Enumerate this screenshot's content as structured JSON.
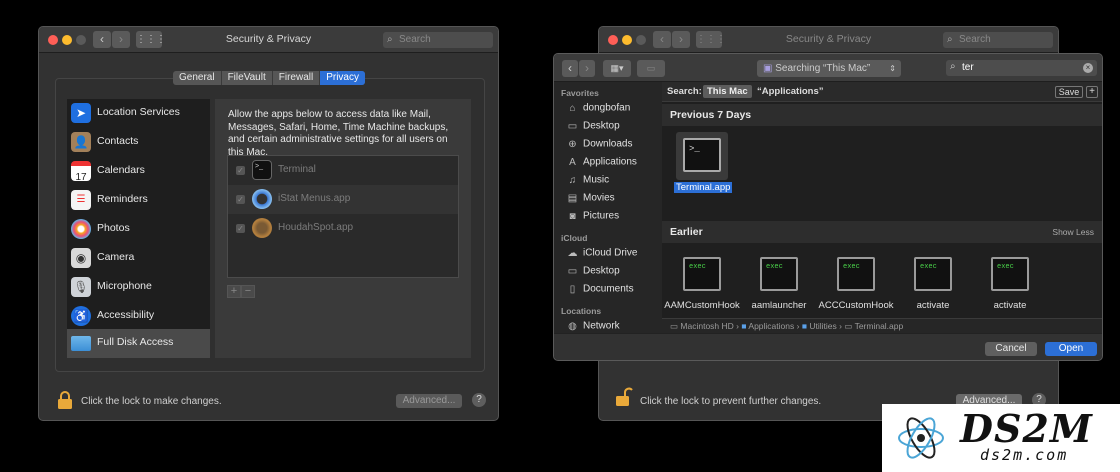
{
  "left_window": {
    "title": "Security & Privacy",
    "search_placeholder": "Search",
    "tabs": [
      "General",
      "FileVault",
      "Firewall",
      "Privacy"
    ],
    "active_tab": "Privacy",
    "sidebar": [
      {
        "label": "Location Services",
        "icon": "location-icon"
      },
      {
        "label": "Contacts",
        "icon": "contacts-icon"
      },
      {
        "label": "Calendars",
        "icon": "calendar-icon",
        "calendar_day": "17"
      },
      {
        "label": "Reminders",
        "icon": "reminders-icon"
      },
      {
        "label": "Photos",
        "icon": "photos-icon"
      },
      {
        "label": "Camera",
        "icon": "camera-icon"
      },
      {
        "label": "Microphone",
        "icon": "microphone-icon"
      },
      {
        "label": "Accessibility",
        "icon": "accessibility-icon"
      },
      {
        "label": "Full Disk Access",
        "icon": "folder-icon",
        "selected": true
      }
    ],
    "description": "Allow the apps below to access data like Mail, Messages, Safari, Home, Time Machine backups, and certain administrative settings for all users on this Mac.",
    "apps": [
      {
        "name": "Terminal",
        "checked": true
      },
      {
        "name": "iStat Menus.app",
        "checked": true
      },
      {
        "name": "HoudahSpot.app",
        "checked": true
      }
    ],
    "add_label": "+",
    "remove_label": "−",
    "lock_text": "Click the lock to make changes.",
    "advanced_label": "Advanced...",
    "help_label": "?"
  },
  "right_window": {
    "title": "Security & Privacy",
    "search_placeholder": "Search",
    "lock_text": "Click the lock to prevent further changes.",
    "advanced_label": "Advanced...",
    "help_label": "?"
  },
  "dialog": {
    "location_popup": "Searching “This Mac”",
    "search_value": "ter",
    "sidebar": {
      "favorites_header": "Favorites",
      "favorites": [
        {
          "label": "dongbofan",
          "icon": "home-icon"
        },
        {
          "label": "Desktop",
          "icon": "desktop-icon"
        },
        {
          "label": "Downloads",
          "icon": "downloads-icon"
        },
        {
          "label": "Applications",
          "icon": "applications-icon"
        },
        {
          "label": "Music",
          "icon": "music-icon"
        },
        {
          "label": "Movies",
          "icon": "movies-icon"
        },
        {
          "label": "Pictures",
          "icon": "pictures-icon"
        }
      ],
      "icloud_header": "iCloud",
      "icloud": [
        {
          "label": "iCloud Drive",
          "icon": "cloud-icon"
        },
        {
          "label": "Desktop",
          "icon": "desktop-icon"
        },
        {
          "label": "Documents",
          "icon": "documents-icon"
        }
      ],
      "locations_header": "Locations",
      "locations": [
        {
          "label": "Network",
          "icon": "network-icon"
        }
      ]
    },
    "scope_label": "Search:",
    "scope_this_mac": "This Mac",
    "scope_applications": "“Applications”",
    "save_label": "Save",
    "plus_label": "+",
    "section_recent": "Previous 7 Days",
    "recent_files": [
      {
        "name": "Terminal.app",
        "icon_text": ">_",
        "selected": true
      }
    ],
    "section_earlier": "Earlier",
    "show_less": "Show Less",
    "earlier_files": [
      {
        "name": "AAMCustomHook",
        "icon_text": "exec"
      },
      {
        "name": "aamlauncher",
        "icon_text": "exec"
      },
      {
        "name": "ACCCustomHook",
        "icon_text": "exec"
      },
      {
        "name": "activate",
        "icon_text": "exec"
      },
      {
        "name": "activate",
        "icon_text": "exec"
      }
    ],
    "path": [
      "Macintosh HD",
      "Applications",
      "Utilities",
      "Terminal.app"
    ],
    "cancel_label": "Cancel",
    "open_label": "Open"
  },
  "watermark": {
    "logo": "DS2M",
    "url": "ds2m.com"
  },
  "colors": {
    "accent": "#2c6fd6",
    "close": "#ff5f57",
    "minimize": "#febc2e",
    "zoom_disabled": "#5a5a5a"
  }
}
